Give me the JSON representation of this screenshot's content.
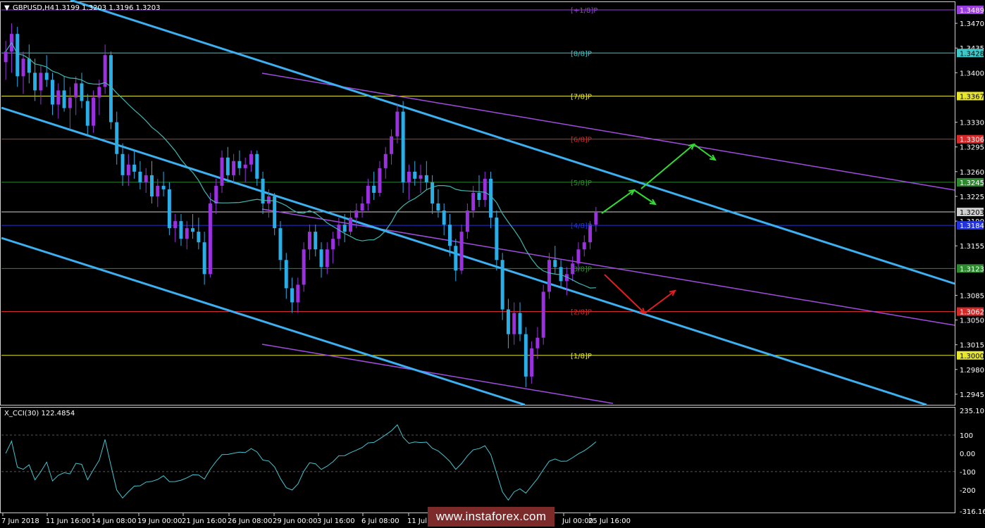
{
  "header": {
    "title": "GBPUSD,H4",
    "ohlc": "1.3199 1.3203 1.3196 1.3203",
    "triangle_glyph": "▼"
  },
  "indicator": {
    "title": "X_CCI(30) 122.4854",
    "ticks": [
      {
        "text": "235.1018",
        "v": 235
      },
      {
        "text": "100",
        "v": 100
      },
      {
        "text": "0.00",
        "v": 0
      },
      {
        "text": "-100",
        "v": -100
      },
      {
        "text": "-200",
        "v": -200
      },
      {
        "text": "-316.1658",
        "v": -316
      }
    ]
  },
  "watermark": "www.instaforex.com",
  "colors": {
    "background": "#000000",
    "bull_candle": "#9b30e0",
    "bear_candle": "#29aee8",
    "channel": "#3cb0f0",
    "purple_line": "#a04ce0",
    "ma": "#3fb8b0",
    "cci": "#46c4d0",
    "green_arrow": "#32dc32",
    "red_arrow": "#e02020"
  },
  "chart_data": {
    "type": "candlestick",
    "symbol": "GBPUSD",
    "timeframe": "H4",
    "ylim": [
      1.293,
      1.35
    ],
    "y_ticks": [
      "1.3470",
      "1.3435",
      "1.3400",
      "1.3330",
      "1.3295",
      "1.3260",
      "1.3225",
      "1.3190",
      "1.3155",
      "1.3085",
      "1.3050",
      "1.3015",
      "1.2980",
      "1.2945"
    ],
    "x_labels": [
      "7 Jun 2018",
      "11 Jun 16:00",
      "14 Jun 08:00",
      "19 Jun 00:00",
      "21 Jun 16:00",
      "26 Jun 08:00",
      "29 Jun 00:00",
      "3 Jul 16:00",
      "6 Jul 08:00",
      "11 Jul 0",
      "Jul 00:00",
      "25 Jul 16:00"
    ],
    "murrey_levels": [
      {
        "label": "[+1/8]P",
        "price": 1.3489,
        "tag": "1.3489",
        "color": "#9a3ee0"
      },
      {
        "label": "[8/8]P",
        "price": 1.3428,
        "tag": "1.3428",
        "color": "#3fc6c6"
      },
      {
        "label": "[7/8]P",
        "price": 1.3367,
        "tag": "1.3367",
        "color": "#e6e62e"
      },
      {
        "label": "[6/8]P",
        "price": 1.3306,
        "tag": "1.3306",
        "color": "#d42a2a"
      },
      {
        "label": "[5/8]P",
        "price": 1.3245,
        "tag": "1.3245",
        "color": "#2e8a2e"
      },
      {
        "label": "",
        "price": 1.3203,
        "tag": "1.3203",
        "color": "#cfcfcf"
      },
      {
        "label": "[4/8]P",
        "price": 1.3184,
        "tag": "1.3184",
        "color": "#2233dd"
      },
      {
        "label": "[3/8]P",
        "price": 1.3123,
        "tag": "1.3123",
        "color": "#2e8a2e"
      },
      {
        "label": "[2/8]P",
        "price": 1.3062,
        "tag": "1.3062",
        "color": "#d42a2a"
      },
      {
        "label": "[1/8]P",
        "price": 1.3,
        "tag": "1.3000",
        "color": "#e6e62e"
      }
    ],
    "candles": [
      [
        1.3415,
        1.3445,
        1.339,
        1.343
      ],
      [
        1.343,
        1.347,
        1.34,
        1.3455
      ],
      [
        1.3455,
        1.3465,
        1.338,
        1.3395
      ],
      [
        1.3395,
        1.343,
        1.337,
        1.342
      ],
      [
        1.342,
        1.344,
        1.3385,
        1.34
      ],
      [
        1.34,
        1.342,
        1.336,
        1.3375
      ],
      [
        1.3375,
        1.341,
        1.3355,
        1.34
      ],
      [
        1.34,
        1.3425,
        1.338,
        1.339
      ],
      [
        1.339,
        1.34,
        1.334,
        1.3355
      ],
      [
        1.3355,
        1.3385,
        1.3335,
        1.3375
      ],
      [
        1.3375,
        1.3395,
        1.3345,
        1.335
      ],
      [
        1.335,
        1.338,
        1.332,
        1.3365
      ],
      [
        1.3365,
        1.3395,
        1.334,
        1.3385
      ],
      [
        1.3385,
        1.34,
        1.335,
        1.336
      ],
      [
        1.336,
        1.337,
        1.331,
        1.3325
      ],
      [
        1.3325,
        1.3375,
        1.3315,
        1.3365
      ],
      [
        1.3365,
        1.339,
        1.334,
        1.338
      ],
      [
        1.338,
        1.344,
        1.337,
        1.3425
      ],
      [
        1.3425,
        1.343,
        1.332,
        1.333
      ],
      [
        1.333,
        1.3345,
        1.327,
        1.3285
      ],
      [
        1.3285,
        1.33,
        1.324,
        1.3255
      ],
      [
        1.3255,
        1.3285,
        1.324,
        1.327
      ],
      [
        1.327,
        1.329,
        1.325,
        1.326
      ],
      [
        1.326,
        1.3275,
        1.3235,
        1.3245
      ],
      [
        1.3245,
        1.3265,
        1.323,
        1.3255
      ],
      [
        1.3255,
        1.3275,
        1.3215,
        1.3225
      ],
      [
        1.3225,
        1.325,
        1.321,
        1.324
      ],
      [
        1.324,
        1.326,
        1.3225,
        1.3235
      ],
      [
        1.3235,
        1.3245,
        1.317,
        1.318
      ],
      [
        1.318,
        1.32,
        1.316,
        1.319
      ],
      [
        1.319,
        1.32,
        1.3155,
        1.3165
      ],
      [
        1.3165,
        1.319,
        1.315,
        1.318
      ],
      [
        1.318,
        1.32,
        1.3165,
        1.3175
      ],
      [
        1.3175,
        1.3195,
        1.315,
        1.316
      ],
      [
        1.316,
        1.3175,
        1.31,
        1.3115
      ],
      [
        1.3115,
        1.323,
        1.311,
        1.3215
      ],
      [
        1.3215,
        1.325,
        1.32,
        1.324
      ],
      [
        1.324,
        1.329,
        1.323,
        1.328
      ],
      [
        1.328,
        1.3295,
        1.3245,
        1.3255
      ],
      [
        1.3255,
        1.3285,
        1.3245,
        1.3275
      ],
      [
        1.3275,
        1.329,
        1.3255,
        1.3265
      ],
      [
        1.3265,
        1.328,
        1.3245,
        1.327
      ],
      [
        1.327,
        1.329,
        1.326,
        1.3285
      ],
      [
        1.3285,
        1.329,
        1.324,
        1.325
      ],
      [
        1.325,
        1.326,
        1.32,
        1.3215
      ],
      [
        1.3215,
        1.3235,
        1.3195,
        1.3225
      ],
      [
        1.3225,
        1.323,
        1.317,
        1.318
      ],
      [
        1.318,
        1.319,
        1.312,
        1.3135
      ],
      [
        1.3135,
        1.3145,
        1.308,
        1.3095
      ],
      [
        1.3095,
        1.311,
        1.306,
        1.3075
      ],
      [
        1.3075,
        1.311,
        1.306,
        1.31
      ],
      [
        1.31,
        1.316,
        1.309,
        1.315
      ],
      [
        1.315,
        1.3185,
        1.3135,
        1.3175
      ],
      [
        1.3175,
        1.3185,
        1.314,
        1.315
      ],
      [
        1.315,
        1.316,
        1.311,
        1.3125
      ],
      [
        1.3125,
        1.316,
        1.3115,
        1.315
      ],
      [
        1.315,
        1.3175,
        1.313,
        1.3165
      ],
      [
        1.3165,
        1.3195,
        1.3155,
        1.3185
      ],
      [
        1.3185,
        1.32,
        1.316,
        1.3175
      ],
      [
        1.3175,
        1.3205,
        1.317,
        1.3195
      ],
      [
        1.3195,
        1.3215,
        1.318,
        1.3205
      ],
      [
        1.3205,
        1.3225,
        1.3195,
        1.3215
      ],
      [
        1.3215,
        1.325,
        1.3205,
        1.324
      ],
      [
        1.324,
        1.326,
        1.322,
        1.323
      ],
      [
        1.323,
        1.3275,
        1.3225,
        1.3265
      ],
      [
        1.3265,
        1.3295,
        1.325,
        1.3285
      ],
      [
        1.3285,
        1.332,
        1.327,
        1.331
      ],
      [
        1.331,
        1.3355,
        1.33,
        1.3345
      ],
      [
        1.3345,
        1.336,
        1.323,
        1.3245
      ],
      [
        1.3245,
        1.327,
        1.322,
        1.326
      ],
      [
        1.326,
        1.3275,
        1.324,
        1.325
      ],
      [
        1.325,
        1.327,
        1.323,
        1.3255
      ],
      [
        1.3255,
        1.3275,
        1.3235,
        1.3245
      ],
      [
        1.3245,
        1.3255,
        1.32,
        1.3215
      ],
      [
        1.3215,
        1.3235,
        1.3195,
        1.3205
      ],
      [
        1.3205,
        1.3215,
        1.317,
        1.3185
      ],
      [
        1.3185,
        1.32,
        1.314,
        1.3155
      ],
      [
        1.3155,
        1.3165,
        1.3105,
        1.312
      ],
      [
        1.312,
        1.3185,
        1.3115,
        1.3175
      ],
      [
        1.3175,
        1.3215,
        1.3165,
        1.3205
      ],
      [
        1.3205,
        1.324,
        1.3195,
        1.323
      ],
      [
        1.323,
        1.3255,
        1.321,
        1.322
      ],
      [
        1.322,
        1.326,
        1.321,
        1.325
      ],
      [
        1.325,
        1.326,
        1.318,
        1.3195
      ],
      [
        1.3195,
        1.3205,
        1.312,
        1.3135
      ],
      [
        1.3135,
        1.3145,
        1.305,
        1.3065
      ],
      [
        1.3065,
        1.308,
        1.301,
        1.303
      ],
      [
        1.303,
        1.3075,
        1.3015,
        1.306
      ],
      [
        1.306,
        1.3075,
        1.302,
        1.303
      ],
      [
        1.303,
        1.304,
        1.2955,
        1.297
      ],
      [
        1.297,
        1.302,
        1.296,
        1.301
      ],
      [
        1.301,
        1.304,
        1.2995,
        1.3025
      ],
      [
        1.3025,
        1.31,
        1.3015,
        1.309
      ],
      [
        1.309,
        1.3145,
        1.308,
        1.3135
      ],
      [
        1.3135,
        1.3155,
        1.3115,
        1.3125
      ],
      [
        1.3125,
        1.3135,
        1.3095,
        1.3105
      ],
      [
        1.3105,
        1.3125,
        1.3085,
        1.3115
      ],
      [
        1.3115,
        1.314,
        1.3105,
        1.313
      ],
      [
        1.313,
        1.316,
        1.312,
        1.315
      ],
      [
        1.315,
        1.317,
        1.314,
        1.316
      ],
      [
        1.316,
        1.319,
        1.315,
        1.3185
      ],
      [
        1.3185,
        1.321,
        1.3175,
        1.3203
      ]
    ],
    "ma_period": 18,
    "cci_period": 30,
    "cci_last": 122.4854,
    "cci_ylim": [
      -316.1658,
      235.1018
    ]
  }
}
